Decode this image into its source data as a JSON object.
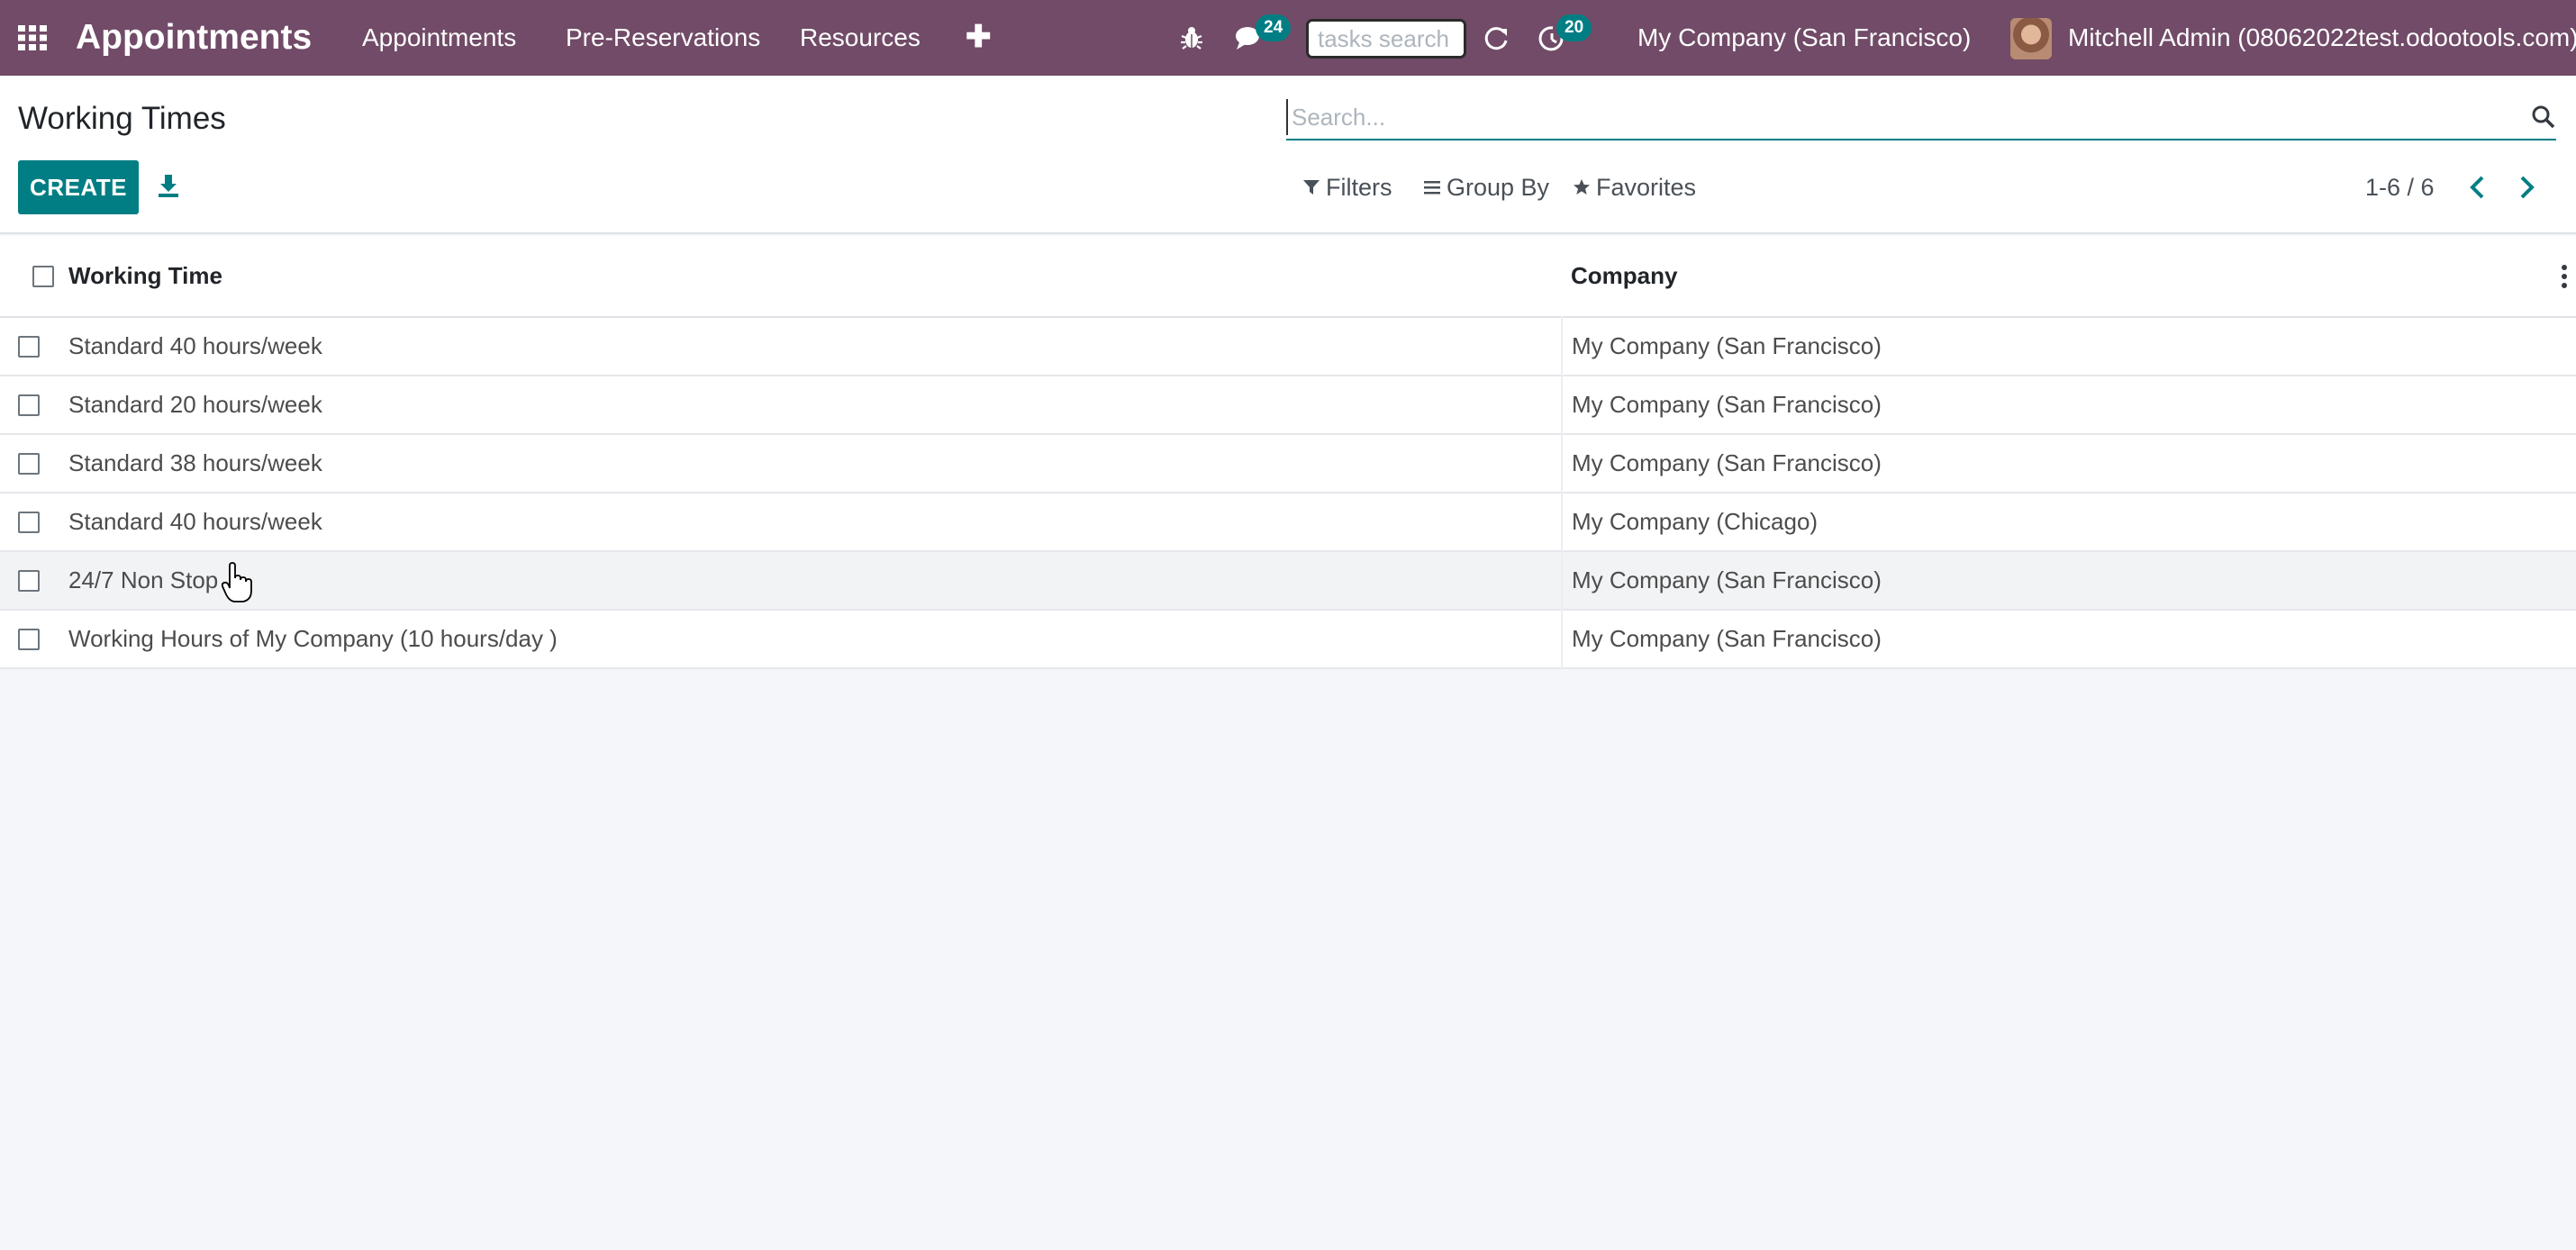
{
  "navbar": {
    "app_name": "Appointments",
    "menu": [
      "Appointments",
      "Pre-Reservations",
      "Resources"
    ],
    "plus_icon": "plus-icon",
    "messages_badge": "24",
    "activity_badge": "20",
    "tasks_search_placeholder": "tasks search",
    "company": "My Company (San Francisco)",
    "user": "Mitchell Admin (08062022test.odootools.com)",
    "color": "#714b67"
  },
  "control_panel": {
    "title": "Working Times",
    "create_label": "CREATE",
    "search_placeholder": "Search...",
    "filters_label": "Filters",
    "group_by_label": "Group By",
    "favorites_label": "Favorites",
    "pager": "1-6 / 6",
    "accent": "#017e84"
  },
  "table": {
    "columns": [
      "Working Time",
      "Company"
    ],
    "rows": [
      {
        "name": "Standard 40 hours/week",
        "company": "My Company (San Francisco)"
      },
      {
        "name": "Standard 20 hours/week",
        "company": "My Company (San Francisco)"
      },
      {
        "name": "Standard 38 hours/week",
        "company": "My Company (San Francisco)"
      },
      {
        "name": "Standard 40 hours/week",
        "company": "My Company (Chicago)"
      },
      {
        "name": "24/7 Non Stop",
        "company": "My Company (San Francisco)"
      },
      {
        "name": "Working Hours of My Company (10 hours/day )",
        "company": "My Company (San Francisco)"
      }
    ]
  }
}
